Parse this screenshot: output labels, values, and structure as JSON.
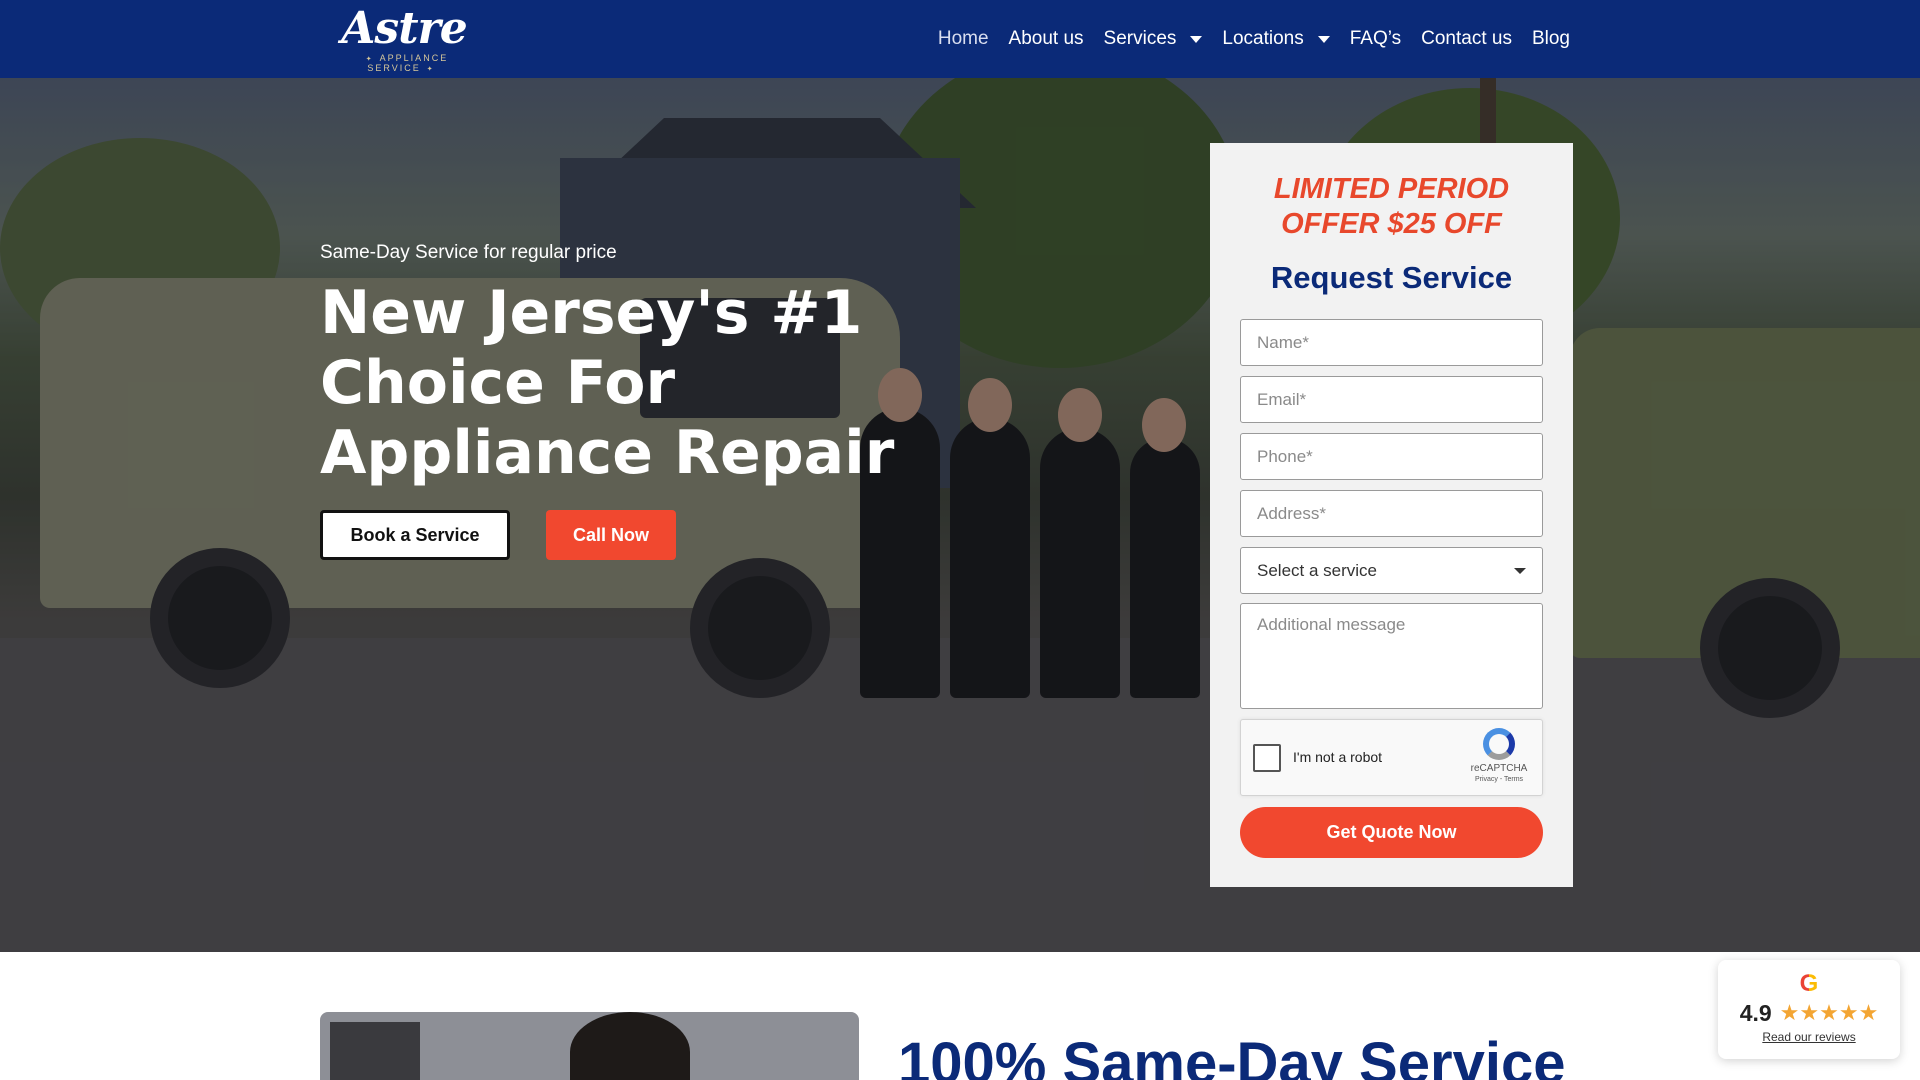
{
  "brand": {
    "name": "Astre",
    "subtitle": "APPLIANCE SERVICE"
  },
  "nav": {
    "items": [
      {
        "label": "Home"
      },
      {
        "label": "About us"
      },
      {
        "label": "Services"
      },
      {
        "label": "Locations"
      },
      {
        "label": "FAQ’s"
      },
      {
        "label": "Contact us"
      },
      {
        "label": "Blog"
      }
    ]
  },
  "hero": {
    "tagline": "Same-Day Service for regular price",
    "headline": "New Jersey's #1 Choice For Appliance Repair",
    "book_label": "Book a Service",
    "call_label": "Call Now"
  },
  "form": {
    "offer_line1": "LIMITED PERIOD",
    "offer_line2": "OFFER $25 OFF",
    "title": "Request Service",
    "name_placeholder": "Name*",
    "email_placeholder": "Email*",
    "phone_placeholder": "Phone*",
    "address_placeholder": "Address*",
    "service_select": "Select a service",
    "message_placeholder": "Additional message",
    "captcha_label": "I'm not a robot",
    "captcha_brand": "reCAPTCHA",
    "captcha_links": "Privacy - Terms",
    "submit_label": "Get Quote Now"
  },
  "section": {
    "title": "100% Same-Day Service"
  },
  "reviews": {
    "rating": "4.9",
    "stars": "★★★★★",
    "link_label": "Read our reviews",
    "g_letter": "G"
  },
  "colors": {
    "navy": "#0b2a78",
    "accent": "#f1482f",
    "offer": "#e8482c",
    "star": "#f3a533"
  },
  "icons": [
    "chevron-down-icon",
    "google-icon",
    "recaptcha-icon",
    "star-icon"
  ]
}
